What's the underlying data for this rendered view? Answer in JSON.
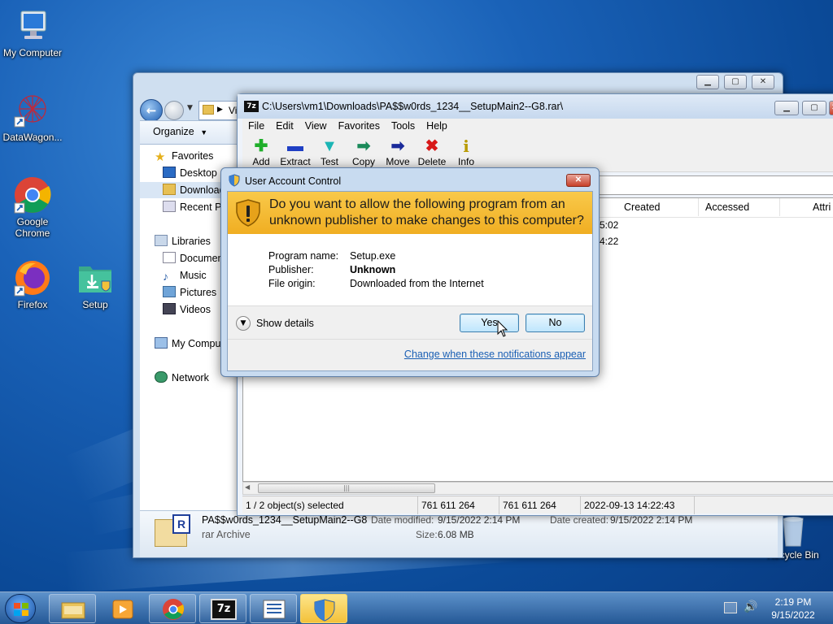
{
  "desktop": {
    "icons": [
      {
        "label": "My Computer",
        "icon": "computer-icon"
      },
      {
        "label": "DataWagon...",
        "icon": "datawagon-icon"
      },
      {
        "label": "Google Chrome",
        "icon": "chrome-icon"
      },
      {
        "label": "Firefox",
        "icon": "firefox-icon"
      },
      {
        "label": "Setup",
        "icon": "setup-folder-icon"
      },
      {
        "label": "Recycle Bin",
        "icon": "recycle-bin-icon"
      }
    ]
  },
  "explorer": {
    "address_fragment": "Vi",
    "organize_label": "Organize",
    "nav": {
      "favorites": "Favorites",
      "desktop": "Desktop",
      "downloads": "Downloads",
      "recent": "Recent Places",
      "libraries": "Libraries",
      "documents": "Documents",
      "music": "Music",
      "pictures": "Pictures",
      "videos": "Videos",
      "computer": "My Computer",
      "network": "Network"
    },
    "details": {
      "name": "PA$$w0rds_1234__SetupMain2--G8",
      "type": "rar Archive",
      "modified_label": "Date modified:",
      "modified_value": "9/15/2022 2:14 PM",
      "created_label": "Date created:",
      "created_value": "9/15/2022 2:14 PM",
      "size_label": "Size:",
      "size_value": "6.08 MB",
      "file_icon_letter": "R"
    }
  },
  "zip": {
    "title": "C:\\Users\\vm1\\Downloads\\PA$$w0rds_1234__SetupMain2--G8.rar\\",
    "app_icon_text": "7z",
    "menu": [
      "File",
      "Edit",
      "View",
      "Favorites",
      "Tools",
      "Help"
    ],
    "tools": [
      {
        "label": "Add",
        "glyph": "✚",
        "color": "#1fae2a"
      },
      {
        "label": "Extract",
        "glyph": "▬",
        "color": "#1f3fc4"
      },
      {
        "label": "Test",
        "glyph": "▼",
        "color": "#1bb5b5"
      },
      {
        "label": "Copy",
        "glyph": "➡",
        "color": "#1a8a5a"
      },
      {
        "label": "Move",
        "glyph": "➡",
        "color": "#1a2a9a"
      },
      {
        "label": "Delete",
        "glyph": "✖",
        "color": "#d81818"
      },
      {
        "label": "Info",
        "glyph": "i",
        "color": "#b89a00"
      }
    ],
    "columns": [
      "Created",
      "Accessed",
      "Attri"
    ],
    "row_times": [
      "5:02",
      "4:22"
    ],
    "status": {
      "selected": "1 / 2 object(s) selected",
      "size1": "761 611 264",
      "size2": "761 611 264",
      "date": "2022-09-13 14:22:43"
    }
  },
  "uac": {
    "title": "User Account Control",
    "question": "Do you want to allow the following program from an unknown publisher to make changes to this computer?",
    "fields": [
      {
        "label": "Program name:",
        "value": "Setup.exe"
      },
      {
        "label": "Publisher:",
        "value": "Unknown"
      },
      {
        "label": "File origin:",
        "value": "Downloaded from the Internet"
      }
    ],
    "show_details": "Show details",
    "yes": "Yes",
    "no": "No",
    "link": "Change when these notifications appear"
  },
  "taskbar": {
    "apps": [
      "explorer-icon",
      "media-player-icon",
      "chrome-icon",
      "7zip-icon",
      "list-app-icon",
      "uac-shield-icon"
    ],
    "seven_zip_text": "7z",
    "time": "2:19 PM",
    "date": "9/15/2022"
  },
  "colors": {
    "uac_banner": "#f0ae22",
    "link": "#1a5fb4",
    "taskbar_active": "#f3c13a"
  }
}
